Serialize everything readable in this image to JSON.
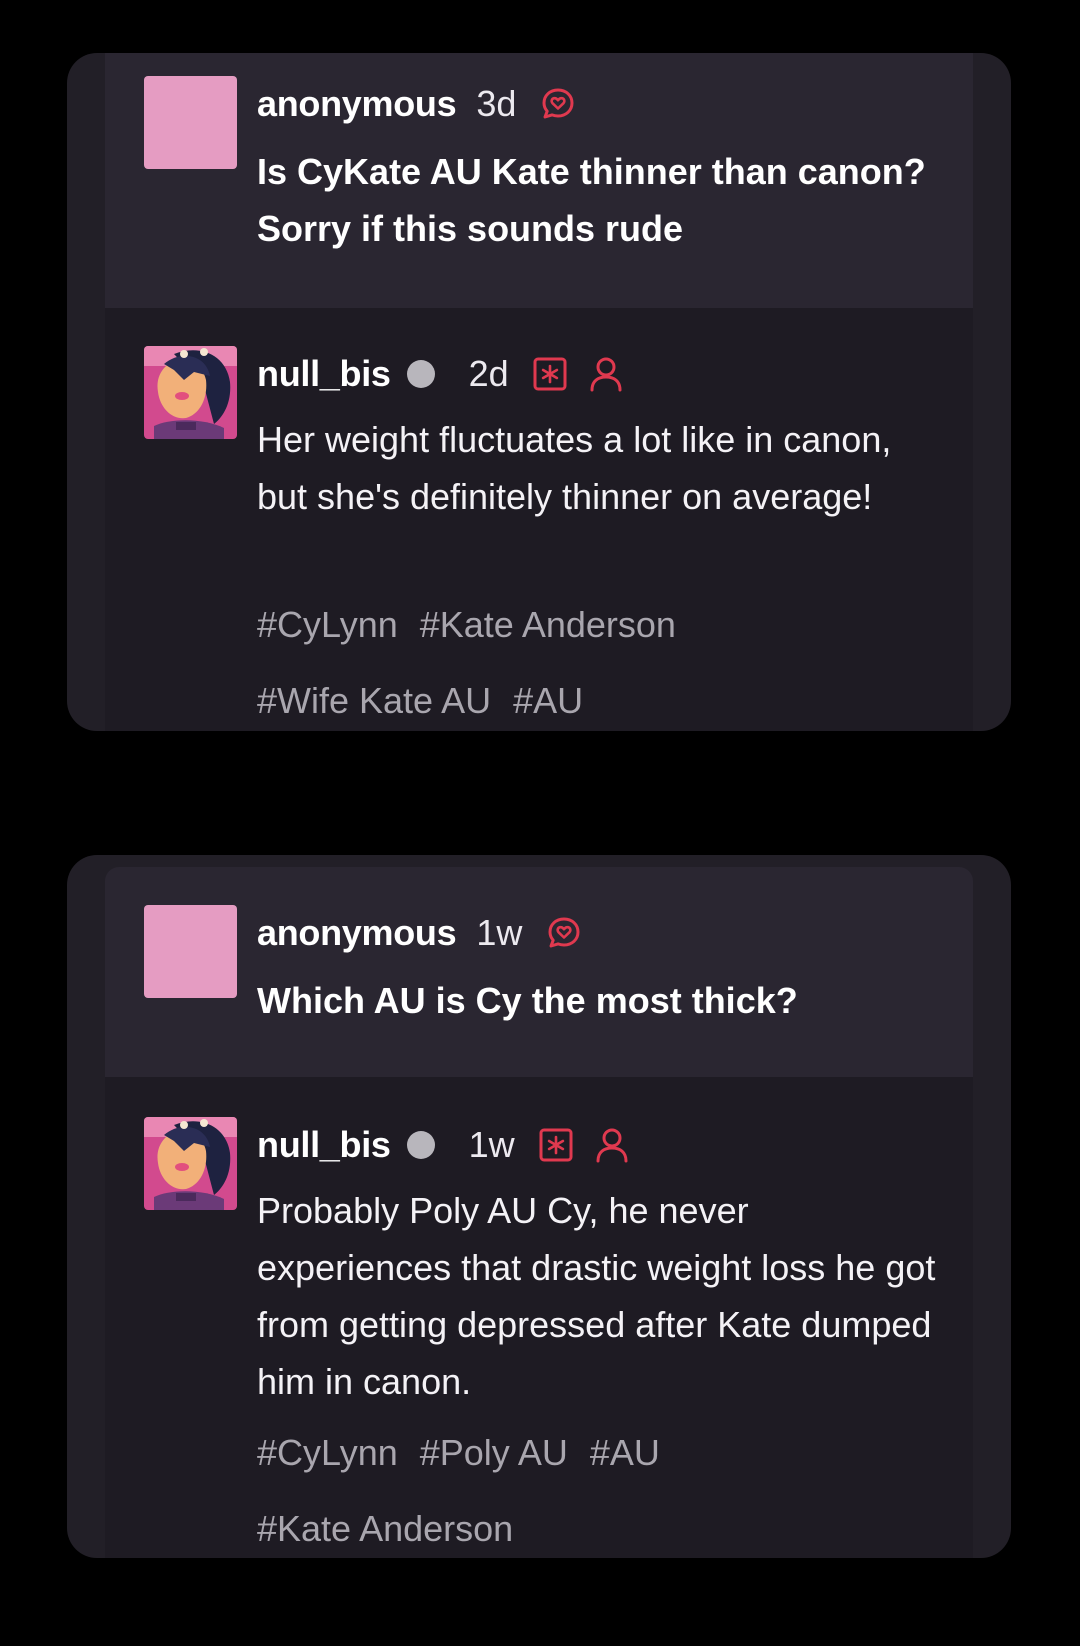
{
  "posts": [
    {
      "question": {
        "author": "anonymous",
        "time": "3d",
        "text": "Is CyKate AU Kate thinner than canon? Sorry if this sounds rude"
      },
      "answer": {
        "author": "null_bis",
        "time": "2d",
        "text": "Her weight fluctuates a lot like in canon, but she's definitely thinner on average!",
        "tag_lines": [
          [
            "#CyLynn",
            "#Kate Anderson"
          ],
          [
            "#Wife Kate AU",
            "#AU"
          ]
        ]
      }
    },
    {
      "question": {
        "author": "anonymous",
        "time": "1w",
        "text": "Which AU is Cy the most thick?"
      },
      "answer": {
        "author": "null_bis",
        "time": "1w",
        "text": "Probably Poly AU Cy, he never experiences that drastic weight loss he got from getting depressed after Kate dumped him in canon.",
        "tag_lines": [
          [
            "#CyLynn",
            "#Poly AU",
            "#AU"
          ],
          [
            "#Kate Anderson"
          ]
        ]
      }
    }
  ],
  "icons": {
    "ask": "ask-bubble-heart-icon",
    "badge": "asterisk-badge-icon",
    "person": "person-icon",
    "status": "status-dot"
  },
  "colors": {
    "page_bg": "#000000",
    "card_bg": "#221f27",
    "ask_bg": "#2a2631",
    "accent_red": "#e0394f",
    "anon_avatar": "#e59cc2",
    "tag_text": "#a9a6ae",
    "status_dot": "#b8b6bc"
  }
}
